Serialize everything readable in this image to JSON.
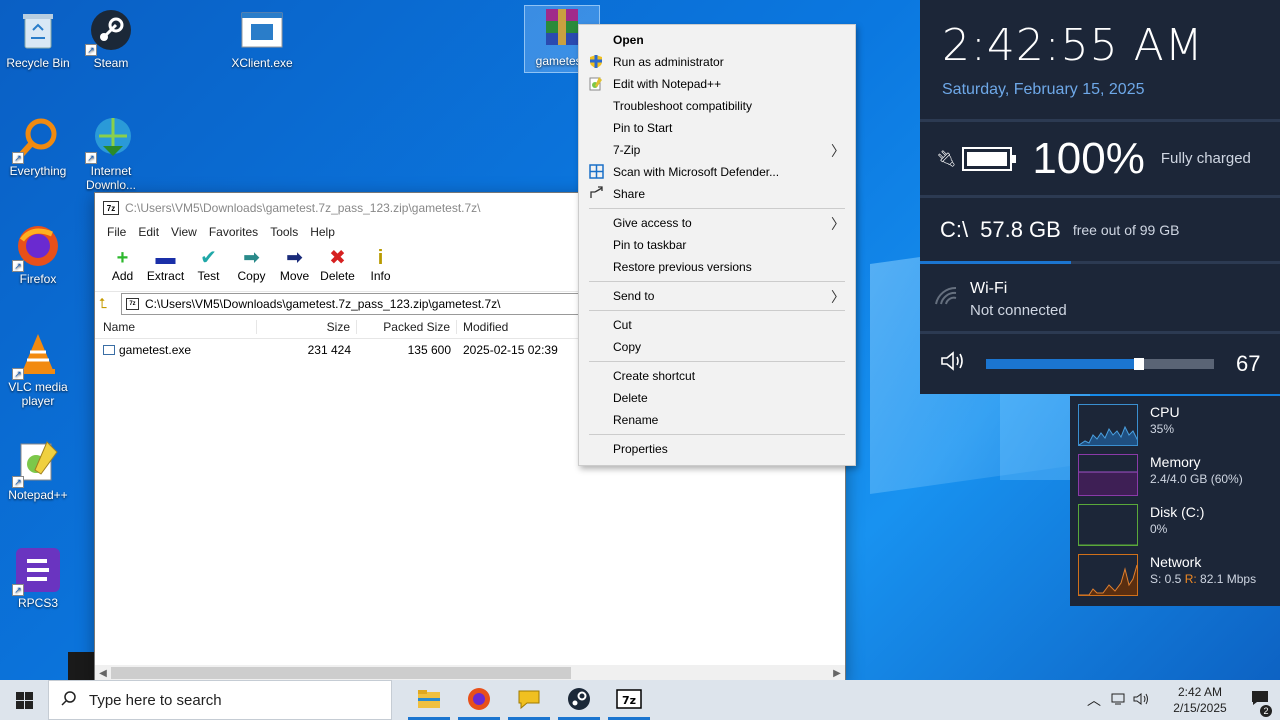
{
  "desktop_icons": [
    {
      "label": "Recycle Bin",
      "icon": "recycle-bin-icon"
    },
    {
      "label": "Steam",
      "icon": "steam-icon"
    },
    {
      "label": "XClient.exe",
      "icon": "exe-icon"
    },
    {
      "label": "gametest.",
      "icon": "winrar-archive-icon"
    },
    {
      "label": "Everything",
      "icon": "everything-search-icon"
    },
    {
      "label": "Internet Downlo...",
      "icon": "internet-download-manager-icon"
    },
    {
      "label": "Firefox",
      "icon": "firefox-icon"
    },
    {
      "label": "VLC media player",
      "icon": "vlc-icon"
    },
    {
      "label": "Notepad++",
      "icon": "notepadpp-icon"
    },
    {
      "label": "RPCS3",
      "icon": "rpcs3-icon"
    }
  ],
  "zip_window": {
    "title": "C:\\Users\\VM5\\Downloads\\gametest.7z_pass_123.zip\\gametest.7z\\",
    "menu": [
      "File",
      "Edit",
      "View",
      "Favorites",
      "Tools",
      "Help"
    ],
    "toolbar": [
      {
        "label": "Add",
        "glyph": "+",
        "color": "#2db82d"
      },
      {
        "label": "Extract",
        "glyph": "▬",
        "color": "#1a2fa8"
      },
      {
        "label": "Test",
        "glyph": "✔",
        "color": "#20a8a8"
      },
      {
        "label": "Copy",
        "glyph": "➡",
        "color": "#2a8a8a"
      },
      {
        "label": "Move",
        "glyph": "➡",
        "color": "#1a2b7a"
      },
      {
        "label": "Delete",
        "glyph": "✖",
        "color": "#d62020"
      },
      {
        "label": "Info",
        "glyph": "i",
        "color": "#b89a00"
      }
    ],
    "address": "C:\\Users\\VM5\\Downloads\\gametest.7z_pass_123.zip\\gametest.7z\\",
    "columns": {
      "name": "Name",
      "size": "Size",
      "packed": "Packed Size",
      "modified": "Modified"
    },
    "rows": [
      {
        "name": "gametest.exe",
        "size": "231 424",
        "packed": "135 600",
        "modified": "2025-02-15 02:39"
      }
    ]
  },
  "context_menu": {
    "groups": [
      [
        {
          "label": "Open",
          "bold": true
        },
        {
          "label": "Run as administrator",
          "icon": "uac-shield-icon"
        },
        {
          "label": "Edit with Notepad++",
          "icon": "notepadpp-icon"
        },
        {
          "label": "Troubleshoot compatibility"
        },
        {
          "label": "Pin to Start"
        },
        {
          "label": "7-Zip",
          "submenu": true
        },
        {
          "label": "Scan with Microsoft Defender...",
          "icon": "defender-icon"
        },
        {
          "label": "Share",
          "icon": "share-icon"
        }
      ],
      [
        {
          "label": "Give access to",
          "submenu": true
        },
        {
          "label": "Pin to taskbar"
        },
        {
          "label": "Restore previous versions"
        }
      ],
      [
        {
          "label": "Send to",
          "submenu": true
        }
      ],
      [
        {
          "label": "Cut"
        },
        {
          "label": "Copy"
        }
      ],
      [
        {
          "label": "Create shortcut"
        },
        {
          "label": "Delete"
        },
        {
          "label": "Rename"
        }
      ],
      [
        {
          "label": "Properties"
        }
      ]
    ]
  },
  "panel": {
    "time": "2:42:55 AM",
    "date": "Saturday, February 15, 2025",
    "battery_pct": "100%",
    "battery_status": "Fully charged",
    "disk_drive": "C:\\",
    "disk_free": "57.8 GB",
    "disk_text": "free out of 99 GB",
    "disk_used_fraction": 0.42,
    "wifi_name": "Wi-Fi",
    "wifi_status": "Not connected",
    "volume": "67",
    "volume_level": 0.67
  },
  "resources": [
    {
      "name": "CPU",
      "value": "35%",
      "color": "#3a8fd0"
    },
    {
      "name": "Memory",
      "value": "2.4/4.0 GB (60%)",
      "color": "#8a3aa8"
    },
    {
      "name": "Disk (C:)",
      "value": "0%",
      "color": "#5aa83a"
    },
    {
      "name": "Network",
      "value_s": "S: 0.5",
      "value_r_label": "R:",
      "value_r": "82.1 Mbps",
      "color": "#d0701a"
    }
  ],
  "taskbar": {
    "search_placeholder": "Type here to search",
    "apps": [
      "file-explorer-icon",
      "firefox-icon",
      "speech-bubble-app-icon",
      "steam-icon",
      "7zip-icon"
    ],
    "clock_time": "2:42 AM",
    "clock_date": "2/15/2025",
    "notification_count": "2"
  }
}
